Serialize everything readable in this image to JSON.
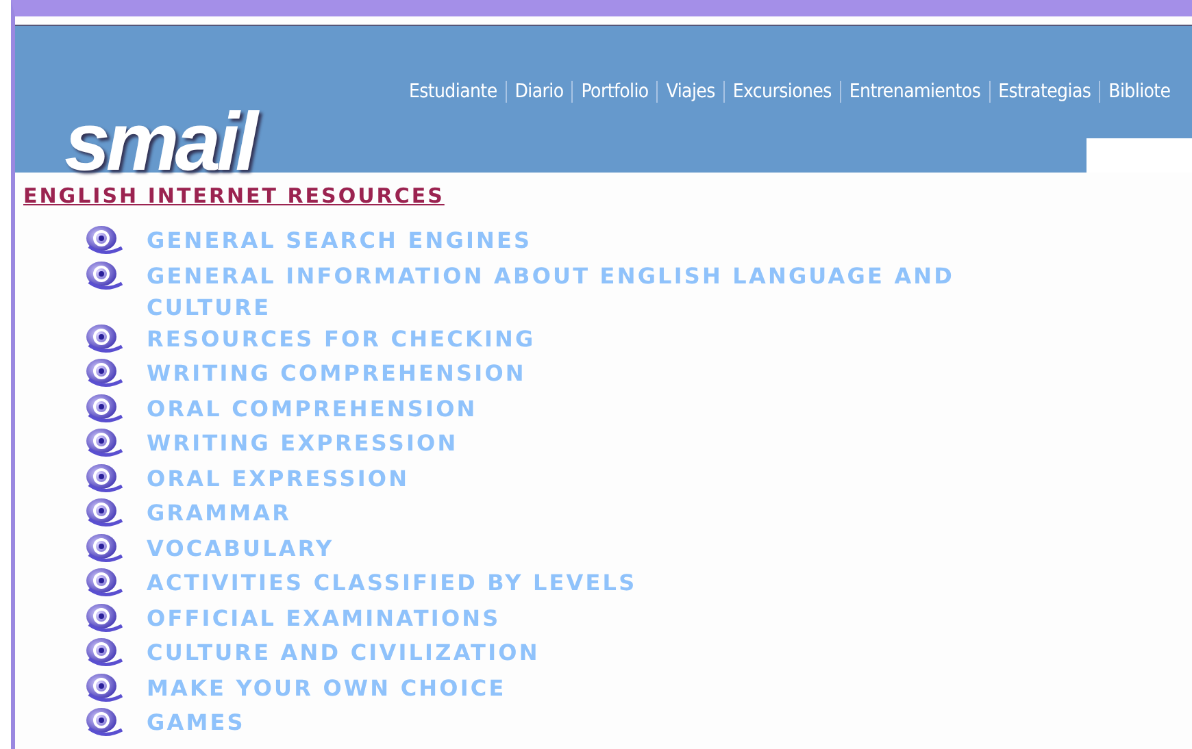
{
  "header": {
    "logo": "smail",
    "nav": [
      "Estudiante",
      "Diario",
      "Portfolio",
      "Viajes",
      "Excursiones",
      "Entrenamientos",
      "Estrategias",
      "Bibliote"
    ]
  },
  "title": "ENGLISH INTERNET RESOURCES",
  "links": [
    {
      "label": "GENERAL SEARCH ENGINES"
    },
    {
      "label": "GENERAL INFORMATION ABOUT ENGLISH LANGUAGE AND CULTURE"
    },
    {
      "label": "RESOURCES FOR CHECKING"
    },
    {
      "label": "WRITING COMPREHENSION"
    },
    {
      "label": "ORAL COMPREHENSION"
    },
    {
      "label": "WRITING EXPRESSION"
    },
    {
      "label": "ORAL EXPRESSION"
    },
    {
      "label": "GRAMMAR"
    },
    {
      "label": "VOCABULARY"
    },
    {
      "label": "ACTIVITIES CLASSIFIED BY LEVELS"
    },
    {
      "label": "OFFICIAL EXAMINATIONS"
    },
    {
      "label": "CULTURE AND CIVILIZATION"
    },
    {
      "label": "MAKE YOUR OWN CHOICE"
    },
    {
      "label": "GAMES"
    }
  ]
}
